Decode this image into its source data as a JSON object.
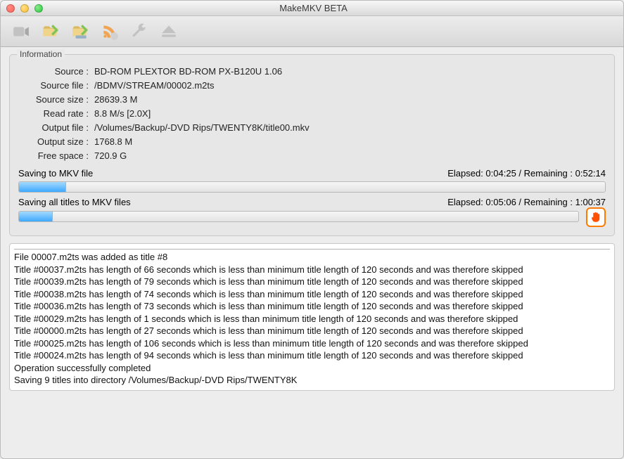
{
  "window": {
    "title": "MakeMKV BETA"
  },
  "toolbar": {
    "buttons": [
      {
        "name": "open-disc-button"
      },
      {
        "name": "open-folder-button"
      },
      {
        "name": "open-files-button"
      },
      {
        "name": "stream-button"
      },
      {
        "name": "settings-button"
      },
      {
        "name": "eject-button"
      }
    ]
  },
  "info": {
    "title": "Information",
    "rows": {
      "source_label": "Source :",
      "source_value": "BD-ROM PLEXTOR BD-ROM PX-B120U 1.06",
      "sourcefile_label": "Source file :",
      "sourcefile_value": "/BDMV/STREAM/00002.m2ts",
      "sourcesize_label": "Source size :",
      "sourcesize_value": "28639.3 M",
      "readrate_label": "Read rate :",
      "readrate_value": "8.8 M/s [2.0X]",
      "outputfile_label": "Output file :",
      "outputfile_value": "/Volumes/Backup/-DVD Rips/TWENTY8K/title00.mkv",
      "outputsize_label": "Output size :",
      "outputsize_value": "1768.8 M",
      "freespace_label": "Free space :",
      "freespace_value": "720.9 G"
    },
    "progress": {
      "p1_label": "Saving to MKV file",
      "p1_time": "Elapsed: 0:04:25 / Remaining : 0:52:14",
      "p1_percent": 8,
      "p2_label": "Saving all titles to MKV files",
      "p2_time": "Elapsed: 0:05:06 / Remaining : 1:00:37",
      "p2_percent": 6
    }
  },
  "log": [
    "File 00007.m2ts was added as title #8",
    "Title #00037.m2ts has length of 66 seconds which is less than minimum title length of 120 seconds and was therefore skipped",
    "Title #00039.m2ts has length of 79 seconds which is less than minimum title length of 120 seconds and was therefore skipped",
    "Title #00038.m2ts has length of 74 seconds which is less than minimum title length of 120 seconds and was therefore skipped",
    "Title #00036.m2ts has length of 73 seconds which is less than minimum title length of 120 seconds and was therefore skipped",
    "Title #00029.m2ts has length of 1 seconds which is less than minimum title length of 120 seconds and was therefore skipped",
    "Title #00000.m2ts has length of 27 seconds which is less than minimum title length of 120 seconds and was therefore skipped",
    "Title #00025.m2ts has length of 106 seconds which is less than minimum title length of 120 seconds and was therefore skipped",
    "Title #00024.m2ts has length of 94 seconds which is less than minimum title length of 120 seconds and was therefore skipped",
    "Operation successfully completed",
    "Saving 9 titles into directory /Volumes/Backup/-DVD Rips/TWENTY8K"
  ]
}
